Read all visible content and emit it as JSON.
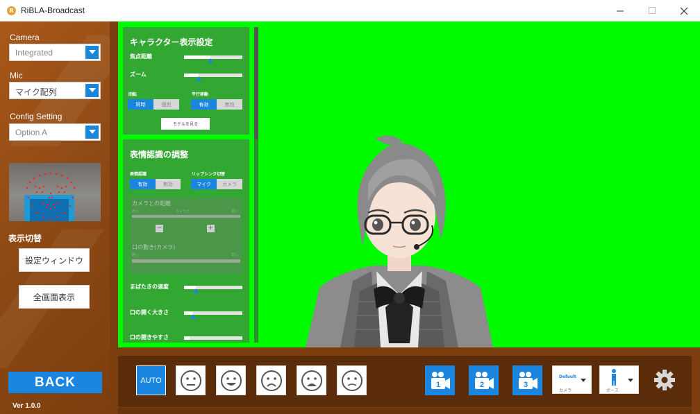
{
  "window": {
    "title": "RiBLA-Broadcast",
    "icon": "app-logo-icon",
    "controls": [
      "minimize-icon",
      "maximize-icon",
      "close-icon"
    ]
  },
  "sidebar": {
    "camera_label": "Camera",
    "camera_value": "Integrated",
    "mic_label": "Mic",
    "mic_value": "マイク配列",
    "config_label": "Config Setting",
    "config_value": "Option A",
    "display_switch_label": "表示切替",
    "settings_window_button": "設定ウィンドウ",
    "fullscreen_button": "全画面表示",
    "back_button": "BACK",
    "version": "Ver 1.0.0"
  },
  "character_settings": {
    "title": "キャラクター表示設定",
    "focal_label": "焦点距離",
    "focal_value": 0.45,
    "zoom_label": "ズーム",
    "zoom_value": 0.25,
    "rotation_label": "回転",
    "rotation_options": [
      "同時",
      "個別"
    ],
    "rotation_selected": "同時",
    "translation_label": "平行移動",
    "translation_options": [
      "有効",
      "無効"
    ],
    "translation_selected": "有効",
    "view_model_button": "モデルを見る"
  },
  "face_settings": {
    "title": "表情認識の調整",
    "recognition_label": "表情認識",
    "recognition_options": [
      "有効",
      "無効"
    ],
    "recognition_selected": "有効",
    "lipsync_label": "リップシンク切替",
    "lipsync_options": [
      "マイク",
      "カメラ"
    ],
    "lipsync_selected": "マイク",
    "camera_distance_label": "カメラとの距離",
    "distance_near": "近い",
    "distance_mid": "ちょうど",
    "distance_far": "遠い",
    "mouth_motion_label": "口の動き(カメラ)",
    "mouth_slow": "遅い",
    "mouth_fast": "早い",
    "blink_speed_label": "まばたきの速度",
    "blink_speed_value": 0.2,
    "mouth_open_label": "口の開く大きさ",
    "mouth_open_value": 0.15,
    "mouth_ease_label": "口の開きやすさ",
    "mouth_ease_value": 0.1
  },
  "bottom_bar": {
    "auto_label": "AUTO",
    "expressions": [
      "neutral-face-icon",
      "happy-face-icon",
      "sad-face-icon",
      "angry-face-icon",
      "worried-face-icon"
    ],
    "cameras": [
      "1",
      "2",
      "3"
    ],
    "camera_dropdown_value": "Default",
    "camera_dropdown_label": "カメラ",
    "pose_dropdown_label": "ポーズ",
    "settings_icon": "gear-icon"
  },
  "colors": {
    "accent_blue": "#1a86e0",
    "chroma_green": "#00fa00",
    "panel_brown": "#8f4a14",
    "settings_card_green": "#32a832"
  }
}
